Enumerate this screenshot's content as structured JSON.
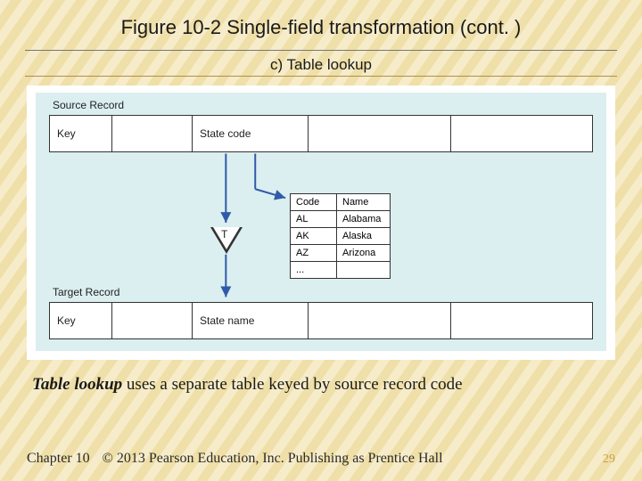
{
  "title": "Figure 10-2 Single-field transformation (cont. )",
  "subtitle": "c) Table lookup",
  "diagram": {
    "source_label": "Source Record",
    "target_label": "Target Record",
    "key_label": "Key",
    "source_field": "State code",
    "target_field": "State name",
    "transform_letter": "T",
    "lookup": {
      "header": {
        "c1": "Code",
        "c2": "Name"
      },
      "rows": [
        {
          "c1": "AL",
          "c2": "Alabama"
        },
        {
          "c1": "AK",
          "c2": "Alaska"
        },
        {
          "c1": "AZ",
          "c2": "Arizona"
        },
        {
          "c1": "...",
          "c2": ""
        }
      ]
    }
  },
  "caption": {
    "bold": "Table lookup",
    "rest": " uses a separate table keyed by source record code"
  },
  "footer": {
    "chapter": "Chapter 10",
    "copyright": "© 2013 Pearson Education, Inc.  Publishing as Prentice Hall",
    "page": "29"
  }
}
